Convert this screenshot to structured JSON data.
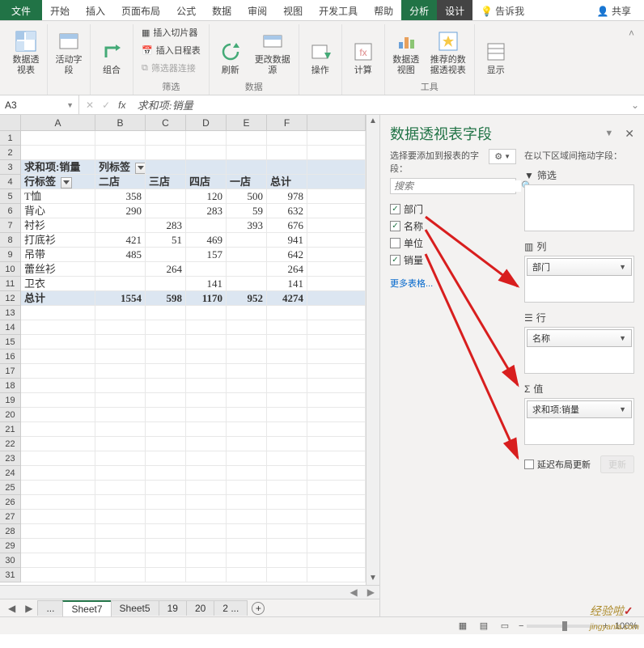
{
  "tabs": {
    "file": "文件",
    "home": "开始",
    "insert": "插入",
    "layout": "页面布局",
    "formulas": "公式",
    "data": "数据",
    "review": "审阅",
    "view": "视图",
    "dev": "开发工具",
    "help": "帮助",
    "analyze": "分析",
    "design": "设计",
    "tell": "告诉我",
    "share": "共享"
  },
  "ribbon": {
    "pivot": "数据透视表",
    "activeField": "活动字段",
    "group": "组合",
    "insertSlicer": "插入切片器",
    "insertTimeline": "插入日程表",
    "filterConn": "筛选器连接",
    "filterGroup": "筛选",
    "refresh": "刷新",
    "changeSource": "更改数据源",
    "dataGroup": "数据",
    "actions": "操作",
    "calc": "计算",
    "pivotChart": "数据透视图",
    "recommended": "推荐的数据透视表",
    "toolsGroup": "工具",
    "show": "显示"
  },
  "nameBox": "A3",
  "formula": "求和项:销量",
  "columns": [
    "A",
    "B",
    "C",
    "D",
    "E",
    "F"
  ],
  "pivot": {
    "sumLabel": "求和项:销量",
    "colLabel": "列标签",
    "rowLabel": "行标签",
    "colHeaders": [
      "二店",
      "三店",
      "四店",
      "一店",
      "总计"
    ],
    "rows": [
      {
        "name": "T恤",
        "vals": [
          "358",
          "",
          "120",
          "500",
          "978"
        ]
      },
      {
        "name": "背心",
        "vals": [
          "290",
          "",
          "283",
          "59",
          "632"
        ]
      },
      {
        "name": "衬衫",
        "vals": [
          "",
          "283",
          "",
          "393",
          "676"
        ]
      },
      {
        "name": "打底衫",
        "vals": [
          "421",
          "51",
          "469",
          "",
          "941"
        ]
      },
      {
        "name": "吊带",
        "vals": [
          "485",
          "",
          "157",
          "",
          "642"
        ]
      },
      {
        "name": "蕾丝衫",
        "vals": [
          "",
          "264",
          "",
          "",
          "264"
        ]
      },
      {
        "name": "卫衣",
        "vals": [
          "",
          "",
          "141",
          "",
          "141"
        ]
      }
    ],
    "totalLabel": "总计",
    "totals": [
      "1554",
      "598",
      "1170",
      "952",
      "4274"
    ]
  },
  "sheets": {
    "ellipsis": "...",
    "s7": "Sheet7",
    "s5": "Sheet5",
    "s19": "19",
    "s20": "20",
    "s2": "2"
  },
  "pane": {
    "title": "数据透视表字段",
    "chooseLabel": "选择要添加到报表的字段：",
    "dragLabel": "在以下区域间拖动字段：",
    "searchPlaceholder": "搜索",
    "fields": [
      {
        "label": "部门",
        "checked": true
      },
      {
        "label": "名称",
        "checked": true
      },
      {
        "label": "单位",
        "checked": false
      },
      {
        "label": "销量",
        "checked": true
      }
    ],
    "moreTables": "更多表格...",
    "filterLabel": "筛选",
    "colsLabel": "列",
    "rowsLabel": "行",
    "valsLabel": "值",
    "colItem": "部门",
    "rowItem": "名称",
    "valItem": "求和项:销量",
    "deferLabel": "延迟布局更新",
    "updateBtn": "更新"
  },
  "status": {
    "zoom": "100%"
  },
  "watermark": {
    "text": "经验啦",
    "domain": "jingyanla.com"
  }
}
